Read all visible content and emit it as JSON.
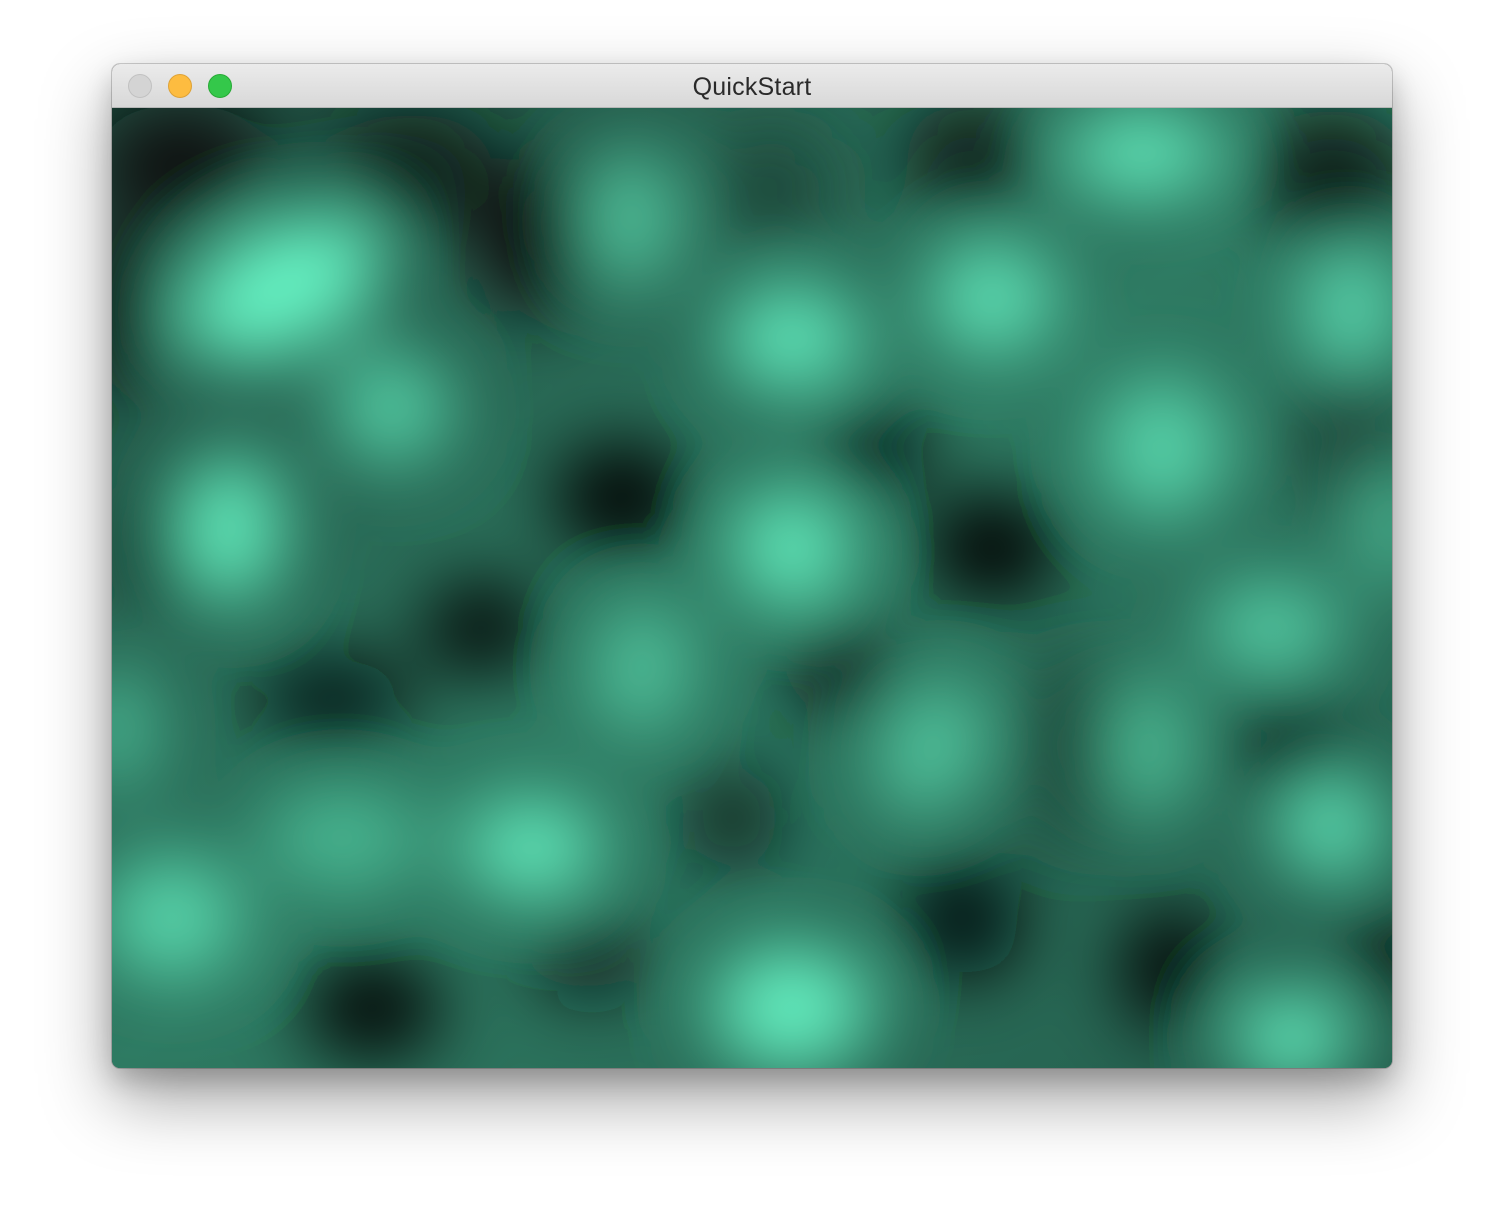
{
  "window": {
    "title": "QuickStart"
  },
  "traffic_lights": {
    "close": "close-button",
    "minimize": "minimize-button",
    "zoom": "zoom-button"
  },
  "canvas": {
    "description_colors": {
      "dark": "#050807",
      "mid": "#2f7a62",
      "bright": "#66f4c4"
    }
  }
}
